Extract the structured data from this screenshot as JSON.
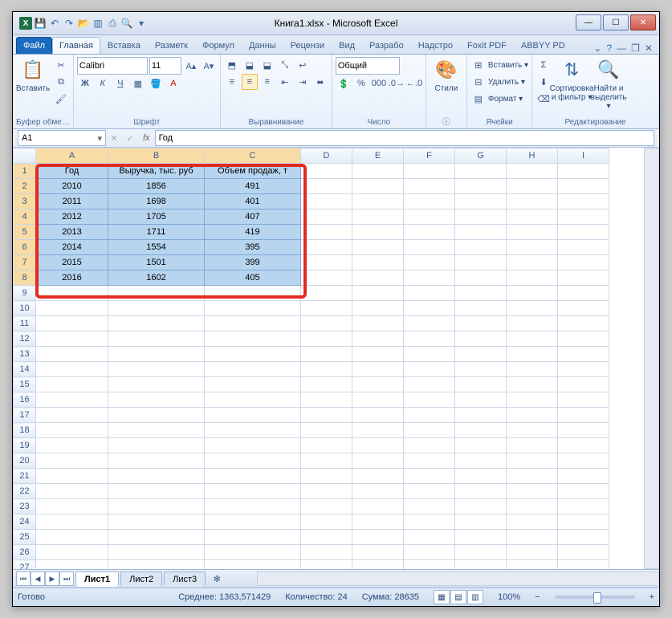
{
  "window": {
    "title": "Книга1.xlsx - Microsoft Excel",
    "qat_icons": [
      "excel",
      "save",
      "undo",
      "redo",
      "open",
      "quickprint",
      "new",
      "print",
      "preview"
    ]
  },
  "tabs": {
    "file": "Файл",
    "items": [
      "Главная",
      "Вставка",
      "Разметк",
      "Формул",
      "Данны",
      "Рецензи",
      "Вид",
      "Разрабо",
      "Надстро",
      "Foxit PDF",
      "ABBYY PD"
    ],
    "active_index": 0
  },
  "ribbon": {
    "clipboard": {
      "label": "Буфер обме…",
      "paste": "Вставить"
    },
    "font": {
      "label": "Шрифт",
      "name": "Calibri",
      "size": "11"
    },
    "align": {
      "label": "Выравнивание"
    },
    "number": {
      "label": "Число",
      "format": "Общий"
    },
    "styles": {
      "label": "ⓘ",
      "btn": "Стили"
    },
    "cells": {
      "label": "Ячейки",
      "insert": "Вставить ▾",
      "delete": "Удалить ▾",
      "format": "Формат ▾"
    },
    "editing": {
      "label": "Редактирование",
      "sort": "Сортировка\nи фильтр ▾",
      "find": "Найти и\nвыделить ▾"
    }
  },
  "namebox": "A1",
  "formula": "Год",
  "columns": [
    "A",
    "B",
    "C",
    "D",
    "E",
    "F",
    "G",
    "H",
    "I"
  ],
  "selected_cols": [
    "A",
    "B",
    "C"
  ],
  "selected_rows": [
    1,
    2,
    3,
    4,
    5,
    6,
    7,
    8
  ],
  "table": {
    "headers": [
      "Год",
      "Выручка, тыс. руб",
      "Объем продаж, т"
    ],
    "rows": [
      [
        "2010",
        "1856",
        "491"
      ],
      [
        "2011",
        "1698",
        "401"
      ],
      [
        "2012",
        "1705",
        "407"
      ],
      [
        "2013",
        "1711",
        "419"
      ],
      [
        "2014",
        "1554",
        "395"
      ],
      [
        "2015",
        "1501",
        "399"
      ],
      [
        "2016",
        "1602",
        "405"
      ]
    ]
  },
  "total_rows": 28,
  "sheets": {
    "items": [
      "Лист1",
      "Лист2",
      "Лист3"
    ],
    "active": 0
  },
  "status": {
    "ready": "Готово",
    "avg_lbl": "Среднее:",
    "avg": "1363,571429",
    "count_lbl": "Количество:",
    "count": "24",
    "sum_lbl": "Сумма:",
    "sum": "28635",
    "zoom": "100%"
  },
  "chart_data": {
    "type": "table",
    "title": "",
    "columns": [
      "Год",
      "Выручка, тыс. руб",
      "Объем продаж, т"
    ],
    "rows": [
      [
        2010,
        1856,
        491
      ],
      [
        2011,
        1698,
        401
      ],
      [
        2012,
        1705,
        407
      ],
      [
        2013,
        1711,
        419
      ],
      [
        2014,
        1554,
        395
      ],
      [
        2015,
        1501,
        399
      ],
      [
        2016,
        1602,
        405
      ]
    ]
  }
}
